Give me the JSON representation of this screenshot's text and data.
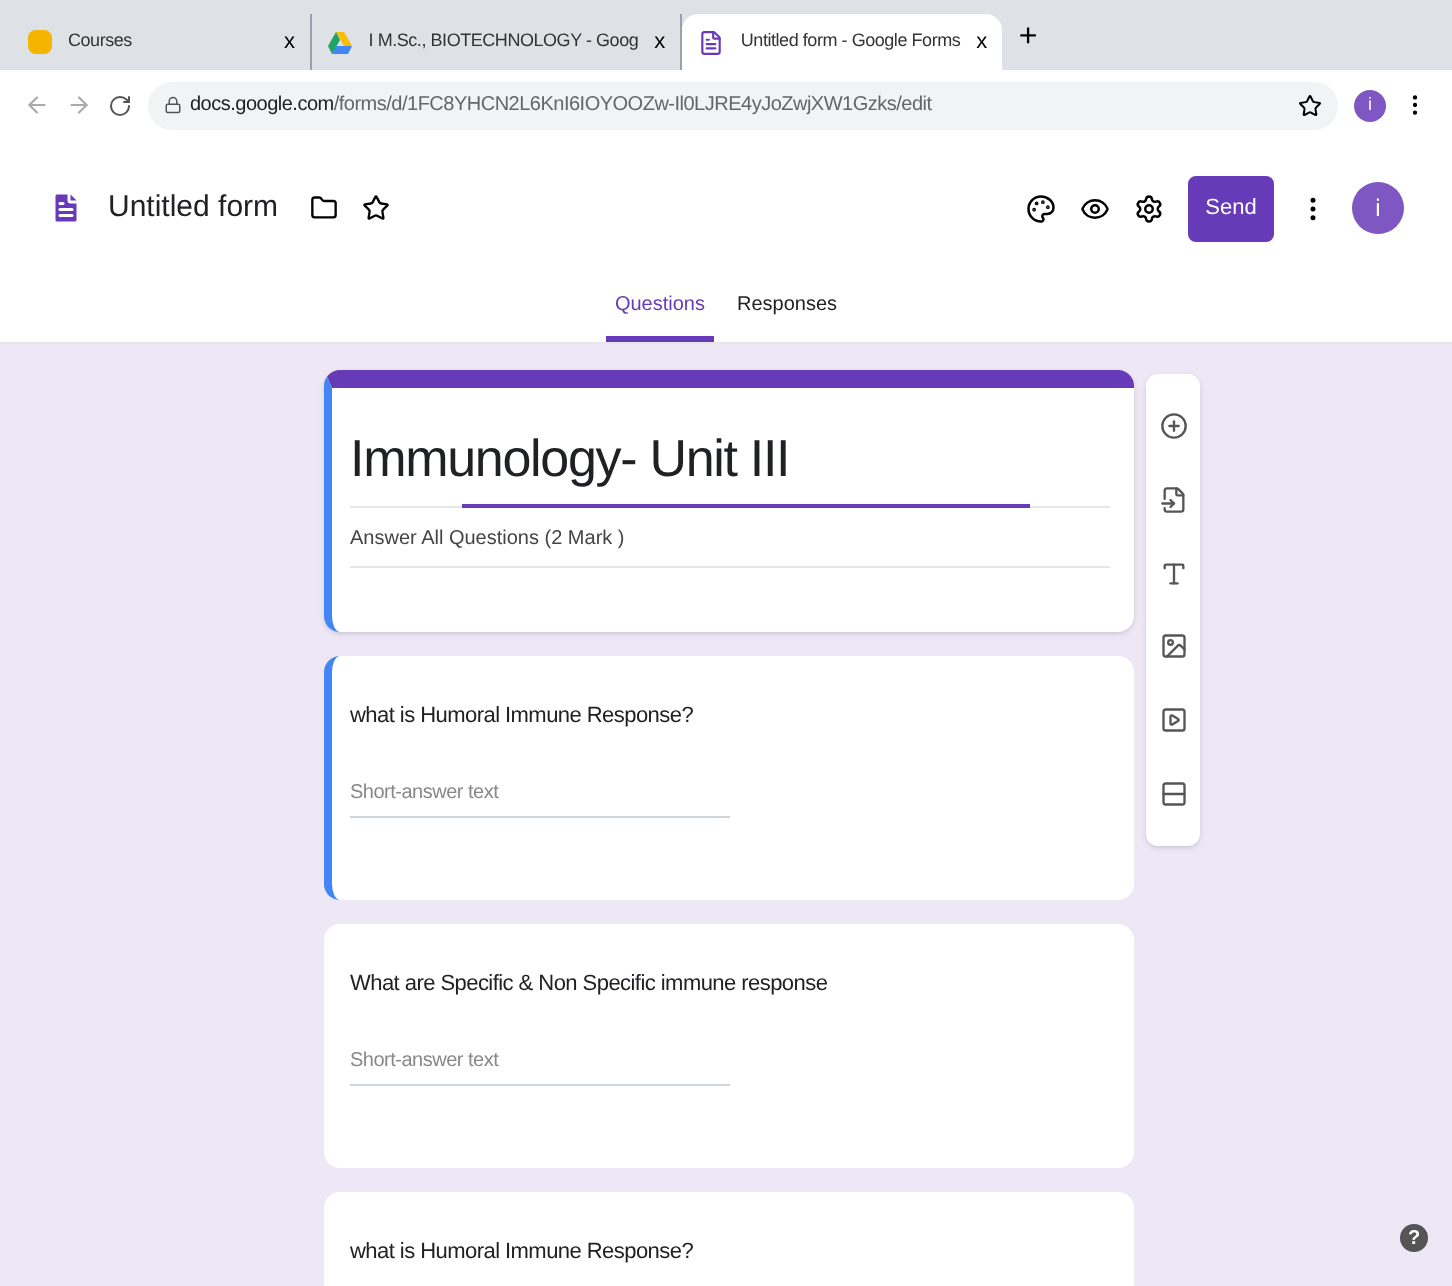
{
  "browser_tabs": [
    {
      "title": "Courses",
      "close": "x",
      "selected": false
    },
    {
      "title": "I M.Sc., BIOTECHNOLOGY - Goog",
      "close": "x",
      "selected": false
    },
    {
      "title": "Untitled form - Google Forms",
      "close": "x",
      "selected": true
    }
  ],
  "new_tab": "+",
  "address": {
    "host": "docs.google.com",
    "path": "/forms/d/1FC8YHCN2L6KnI6IOYOOZw-Il0LJRE4yJoZwjXW1Gzks/edit"
  },
  "profile_initial": "i",
  "header": {
    "title": "Untitled form",
    "send": "Send",
    "avatar": "i"
  },
  "tabs": [
    {
      "label": "Questions",
      "selected": true
    },
    {
      "label": "Responses",
      "selected": false
    }
  ],
  "form": {
    "title": "Immunology- Unit III",
    "description": "Answer All Questions (2 Mark )",
    "highlighted": true
  },
  "questions": [
    {
      "text": "what is Humoral Immune Response?",
      "placeholder": "Short-answer text",
      "highlighted": true
    },
    {
      "text": "What are Specific & Non Specific immune response",
      "placeholder": "Short-answer text",
      "highlighted": false
    },
    {
      "text": "what is Humoral Immune Response?",
      "highlighted": false
    }
  ],
  "help": "?"
}
